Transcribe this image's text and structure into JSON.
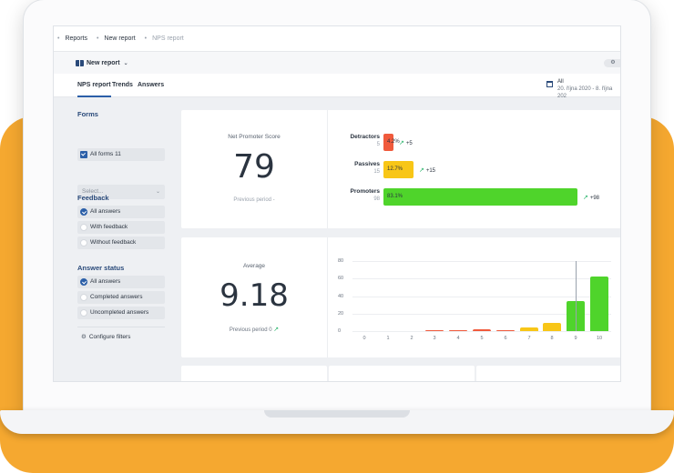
{
  "breadcrumb": [
    "Reports",
    "New report",
    "NPS report"
  ],
  "report_menu": {
    "label": "New report"
  },
  "tabs": [
    "NPS report",
    "Trends",
    "Answers"
  ],
  "period": {
    "label": "All",
    "dates": "20. října 2020 - 8. října 202"
  },
  "sidebar": {
    "forms_title": "Forms",
    "all_forms": "All forms 11",
    "select_placeholder": "Select...",
    "feedback_title": "Feedback",
    "feedback_options": [
      "All answers",
      "With feedback",
      "Without feedback"
    ],
    "status_title": "Answer status",
    "status_options": [
      "All answers",
      "Completed answers",
      "Uncompleted answers"
    ],
    "configure": "Configure filters"
  },
  "nps_card": {
    "title": "Net Promoter Score",
    "value": "79",
    "previous": "Previous period -"
  },
  "nps_breakdown": [
    {
      "label": "Detractors",
      "count": "5",
      "percent": "4.2%",
      "fraction": 0.042,
      "change": "+5",
      "color": "#f05a3c"
    },
    {
      "label": "Passives",
      "count": "15",
      "percent": "12.7%",
      "fraction": 0.127,
      "change": "+15",
      "color": "#f8c617"
    },
    {
      "label": "Promoters",
      "count": "98",
      "percent": "83.1%",
      "fraction": 0.831,
      "change": "+98",
      "color": "#4fd42b"
    }
  ],
  "average_card": {
    "title": "Average",
    "value": "9.18",
    "previous": "Previous period 0"
  },
  "chart_data": {
    "type": "bar",
    "categories": [
      "0",
      "1",
      "2",
      "3",
      "4",
      "5",
      "6",
      "7",
      "8",
      "9",
      "10"
    ],
    "values": [
      0,
      0,
      0,
      1,
      1,
      2,
      1,
      4,
      9,
      34,
      62
    ],
    "ylim": [
      0,
      80
    ],
    "yticks": [
      "80",
      "60",
      "40",
      "20",
      "0"
    ],
    "colors": [
      "#f05a3c",
      "#f05a3c",
      "#f05a3c",
      "#f05a3c",
      "#f05a3c",
      "#f05a3c",
      "#f05a3c",
      "#f8c617",
      "#f8c617",
      "#4fd42b",
      "#4fd42b"
    ],
    "grid": true
  }
}
